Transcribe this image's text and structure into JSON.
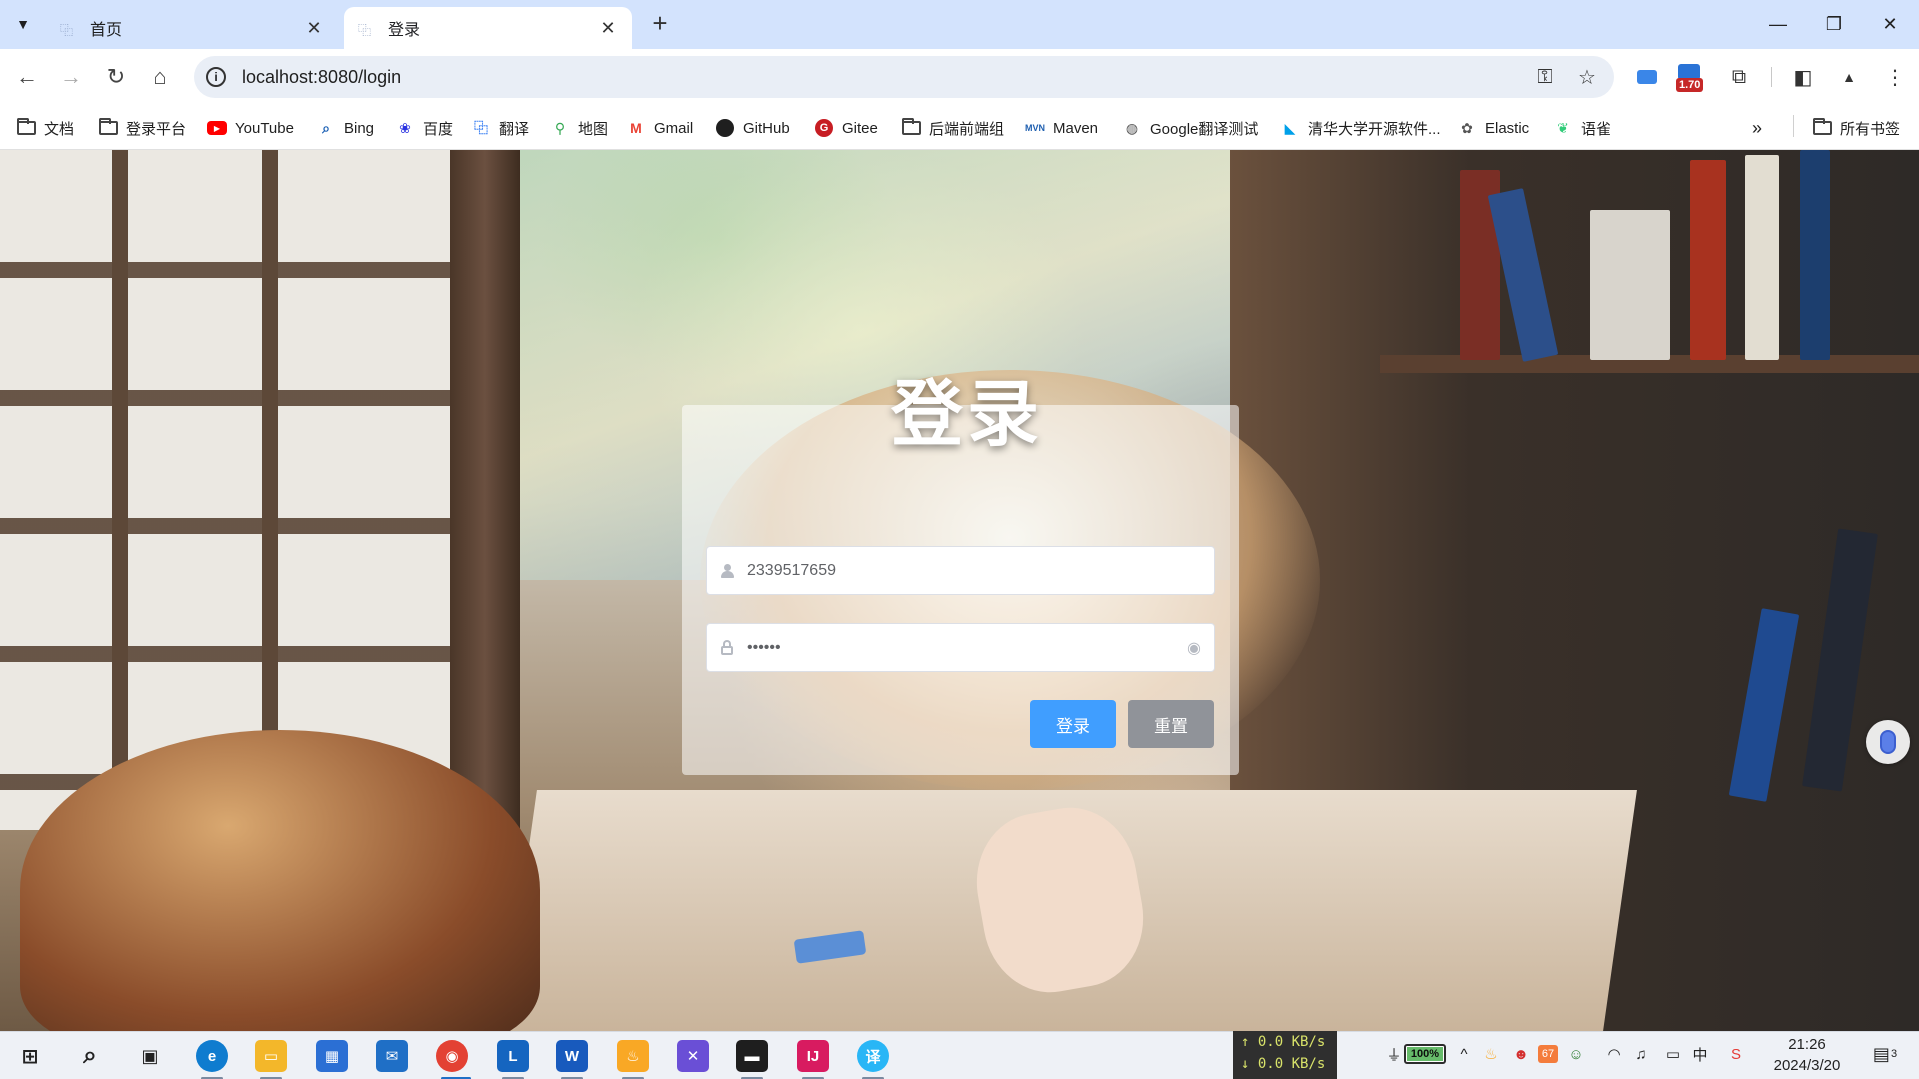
{
  "browser": {
    "tabs": [
      {
        "title": "首页",
        "active": false
      },
      {
        "title": "登录",
        "active": true
      }
    ],
    "new_tab_icon": "plus-icon",
    "url": "localhost:8080/login",
    "extension_badge": "1.70",
    "bookmarks": [
      {
        "label": "文档",
        "icon": "folder-icon"
      },
      {
        "label": "登录平台",
        "icon": "folder-icon"
      },
      {
        "label": "YouTube",
        "icon": "youtube-icon"
      },
      {
        "label": "Bing",
        "icon": "bing-icon"
      },
      {
        "label": "百度",
        "icon": "baidu-icon"
      },
      {
        "label": "翻译",
        "icon": "translate-icon"
      },
      {
        "label": "地图",
        "icon": "maps-icon"
      },
      {
        "label": "Gmail",
        "icon": "gmail-icon"
      },
      {
        "label": "GitHub",
        "icon": "github-icon"
      },
      {
        "label": "Gitee",
        "icon": "gitee-icon"
      },
      {
        "label": "后端前端组",
        "icon": "folder-icon"
      },
      {
        "label": "Maven",
        "icon": "maven-icon"
      },
      {
        "label": "Google翻译测试",
        "icon": "globe-icon"
      },
      {
        "label": "清华大学开源软件...",
        "icon": "tsinghua-icon"
      },
      {
        "label": "Elastic",
        "icon": "elastic-icon"
      },
      {
        "label": "语雀",
        "icon": "yuque-icon"
      }
    ],
    "all_bookmarks": "所有书签"
  },
  "login": {
    "title": "登录",
    "username_value": "2339517659",
    "password_value": "123456",
    "login_button": "登录",
    "reset_button": "重置"
  },
  "taskbar": {
    "net_up": "↑ 0.0 KB/s",
    "net_down": "↓ 0.0 KB/s",
    "battery": "100%",
    "tray_badge": "67",
    "ime": "中",
    "time": "21:26",
    "date": "2024/3/20",
    "notifications": "3"
  },
  "colors": {
    "primary": "#409eff",
    "reset": "#909399",
    "tab_strip": "#d3e3fd"
  }
}
